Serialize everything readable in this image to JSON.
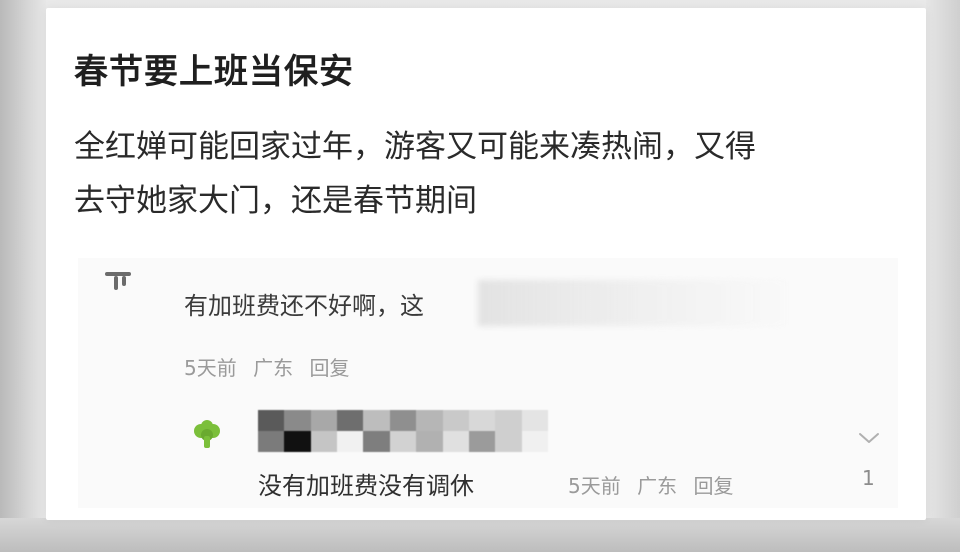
{
  "post": {
    "title": "春节要上班当保安",
    "body_lines": [
      "全红婵可能回家过年，游客又可能来凑热闹，又得",
      "去守她家大门，还是春节期间"
    ]
  },
  "comments": [
    {
      "avatar": "fork-tree-icon",
      "text": "有加班费还不好啊，这",
      "time": "5天前",
      "location": "广东",
      "reply_label": "回复"
    },
    {
      "avatar": "broccoli-tree-icon",
      "username": "",
      "text": "没有加班费没有调休",
      "time": "5天前",
      "location": "广东",
      "reply_label": "回复",
      "likes": "1"
    }
  ],
  "colors": {
    "avatar_green": "#7bbf3a",
    "avatar_dark": "#6b6b6b"
  }
}
